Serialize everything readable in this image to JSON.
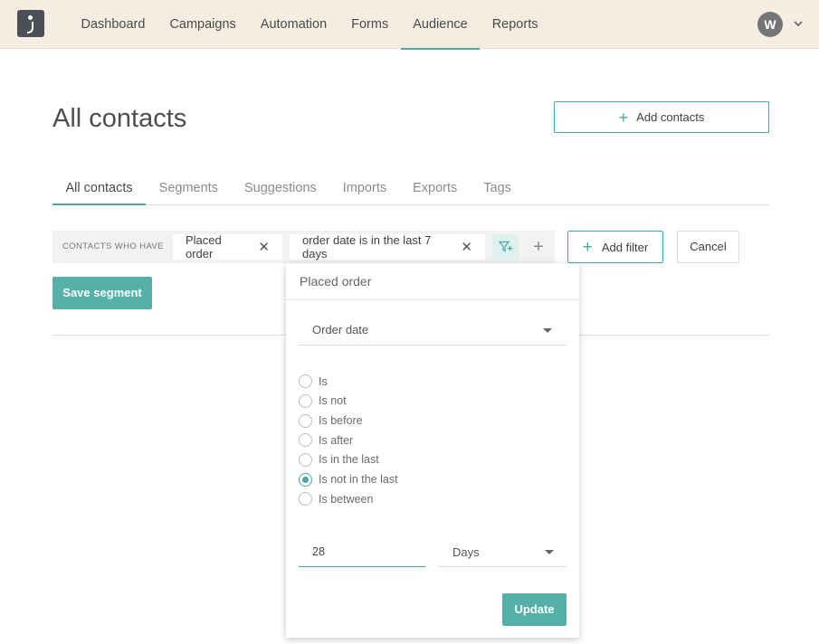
{
  "nav": {
    "items": [
      {
        "label": "Dashboard",
        "active": false
      },
      {
        "label": "Campaigns",
        "active": false
      },
      {
        "label": "Automation",
        "active": false
      },
      {
        "label": "Forms",
        "active": false
      },
      {
        "label": "Audience",
        "active": true
      },
      {
        "label": "Reports",
        "active": false
      }
    ],
    "avatar_initial": "W"
  },
  "page": {
    "title": "All contacts",
    "add_contacts_label": "Add contacts"
  },
  "tabs": [
    {
      "label": "All contacts",
      "active": true
    },
    {
      "label": "Segments",
      "active": false
    },
    {
      "label": "Suggestions",
      "active": false
    },
    {
      "label": "Imports",
      "active": false
    },
    {
      "label": "Exports",
      "active": false
    },
    {
      "label": "Tags",
      "active": false
    }
  ],
  "filter": {
    "label": "CONTACTS WHO HAVE",
    "chips": [
      "Placed order",
      "order date is in the last 7 days"
    ],
    "add_filter_label": "Add filter",
    "cancel_label": "Cancel",
    "save_segment_label": "Save segment"
  },
  "popover": {
    "title": "Placed order",
    "field_select": "Order date",
    "options": [
      {
        "label": "Is",
        "checked": false
      },
      {
        "label": "Is not",
        "checked": false
      },
      {
        "label": "Is before",
        "checked": false
      },
      {
        "label": "Is after",
        "checked": false
      },
      {
        "label": "Is in the last",
        "checked": false
      },
      {
        "label": "Is not in the last",
        "checked": true
      },
      {
        "label": "Is between",
        "checked": false
      }
    ],
    "value": "28",
    "unit": "Days",
    "update_label": "Update"
  },
  "colors": {
    "accent": "#49a9a1",
    "topbar": "#f6ede2",
    "button": "#55b0a8"
  }
}
